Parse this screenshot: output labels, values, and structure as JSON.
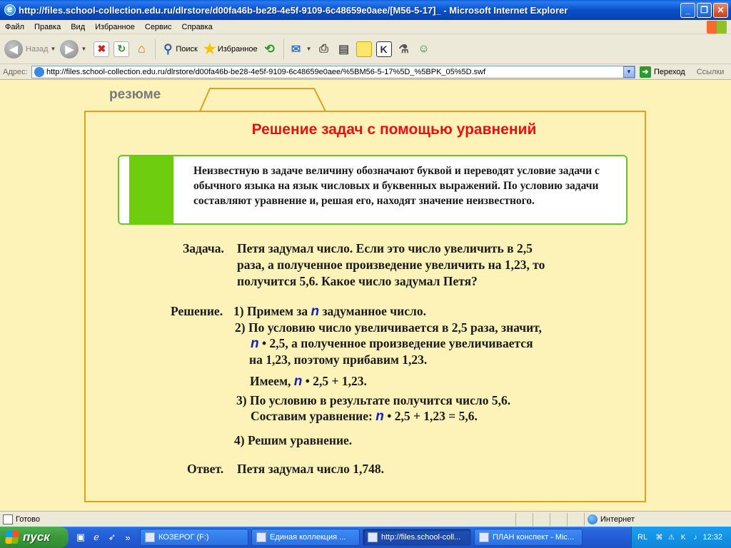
{
  "window": {
    "title": "http://files.school-collection.edu.ru/dlrstore/d00fa46b-be28-4e5f-9109-6c48659e0aee/[M56-5-17]_ - Microsoft Internet Explorer"
  },
  "menu": [
    "Файл",
    "Правка",
    "Вид",
    "Избранное",
    "Сервис",
    "Справка"
  ],
  "toolbar": {
    "back_label": "Назад",
    "search_label": "Поиск",
    "favorites_label": "Избранное"
  },
  "address": {
    "label": "Адрес:",
    "url": "http://files.school-collection.edu.ru/dlrstore/d00fa46b-be28-4e5f-9109-6c48659e0aee/%5BM56-5-17%5D_%5BPK_05%5D.swf",
    "go_label": "Переход",
    "links_label": "Ссылки"
  },
  "lesson": {
    "tab_label": "резюме",
    "title": "Решение задач с помощью уравнений",
    "definition": "Неизвестную в задаче величину обозначают буквой и переводят условие задачи с обычного языка на язык числовых и буквенных выражений. По условию задачи составляют уравнение и, решая его, находят значение неизвестного.",
    "task_label": "Задача.",
    "task_lines": [
      "Петя задумал число. Если это число увеличить в 2,5",
      "раза, а полученное произведение увеличить на 1,23, то",
      "получится 5,6. Какое число задумал Петя?"
    ],
    "var": "n",
    "solution_label": "Решение.",
    "step1_pre": "1) Примем за",
    "step1_post": "задуманное число.",
    "step2_line1": "2) По условию число увеличивается в 2,5 раза, значит,",
    "step2_line2_post": "• 2,5, а полученное произведение увеличивается",
    "step2_line3": "на 1,23, поэтому прибавим 1,23.",
    "have_pre": "Имеем,",
    "have_post": "• 2,5 + 1,23.",
    "step3_line1": "3) По условию в результате получится число 5,6.",
    "step3_pre": "Составим уравнение:",
    "step3_post": "• 2,5 + 1,23 = 5,6.",
    "step4": "4) Решим уравнение.",
    "answer_label": "Ответ.",
    "answer_text": "Петя задумал число 1,748."
  },
  "status": {
    "done": "Готово",
    "zone": "Интернет"
  },
  "taskbar": {
    "start_label": "пуск",
    "buttons": [
      "КОЗЕРОГ (F:)",
      "Единая коллекция ...",
      "http://files.school-coll...",
      "ПЛАН конспект - Mic..."
    ],
    "lang": "RL",
    "clock": "12:32"
  }
}
